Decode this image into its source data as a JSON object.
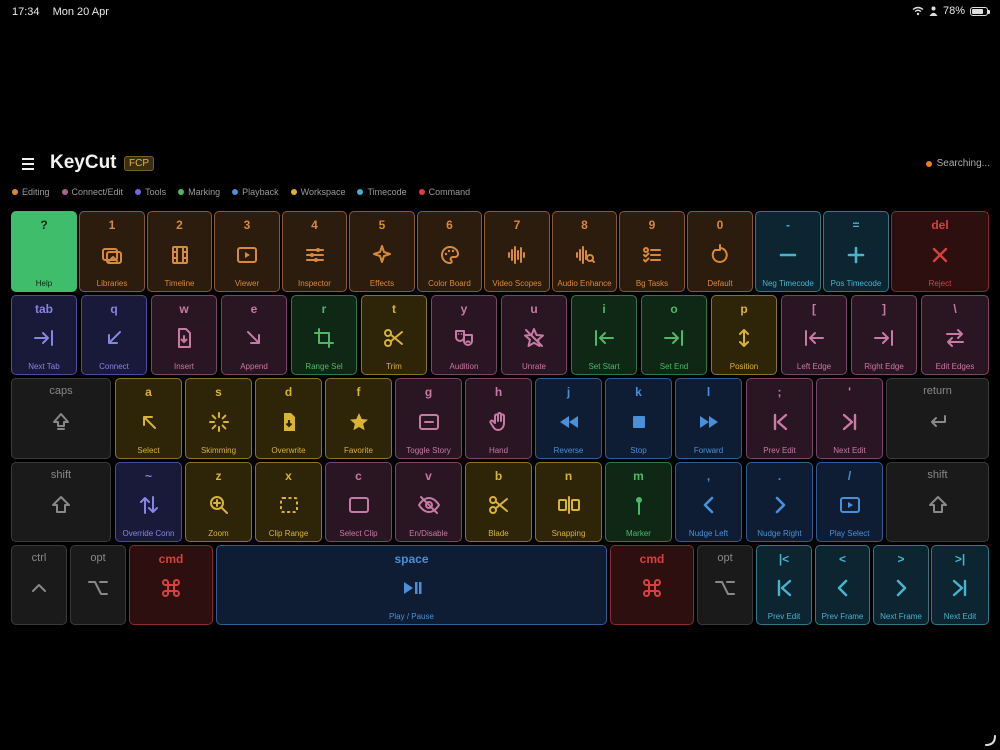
{
  "status_bar": {
    "time": "17:34",
    "date": "Mon 20 Apr",
    "battery": "78%"
  },
  "header": {
    "title": "KeyCut",
    "badge": "FCP",
    "status": "Searching..."
  },
  "colors": {
    "editing": "#d88a3a",
    "connect": "#b06090",
    "tools": "#6d6dd8",
    "marking": "#4fb868",
    "playback": "#4a90d8",
    "workspace": "#d8b430",
    "timecode": "#40b0c8",
    "command": "#d84040",
    "help": "#3fbd6a"
  },
  "legend": [
    {
      "label": "Editing",
      "color": "#d88a3a"
    },
    {
      "label": "Connect/Edit",
      "color": "#b06090"
    },
    {
      "label": "Tools",
      "color": "#6d6dd8"
    },
    {
      "label": "Marking",
      "color": "#4fb868"
    },
    {
      "label": "Playback",
      "color": "#4a90d8"
    },
    {
      "label": "Workspace",
      "color": "#d8b430"
    },
    {
      "label": "Timecode",
      "color": "#40b0c8"
    },
    {
      "label": "Command",
      "color": "#d84040"
    }
  ],
  "keys": [
    {
      "key": "?",
      "label": "Help",
      "cat": "help",
      "icon": ""
    },
    {
      "key": "1",
      "label": "Libraries",
      "cat": "editing",
      "icon": "libraries"
    },
    {
      "key": "2",
      "label": "Timeline",
      "cat": "editing",
      "icon": "film"
    },
    {
      "key": "3",
      "label": "Viewer",
      "cat": "editing",
      "icon": "play-box"
    },
    {
      "key": "4",
      "label": "Inspector",
      "cat": "editing",
      "icon": "sliders"
    },
    {
      "key": "5",
      "label": "Effects",
      "cat": "editing",
      "icon": "sparkle"
    },
    {
      "key": "6",
      "label": "Color Board",
      "cat": "editing",
      "icon": "palette"
    },
    {
      "key": "7",
      "label": "Video Scopes",
      "cat": "editing",
      "icon": "wave"
    },
    {
      "key": "8",
      "label": "Audio Enhance",
      "cat": "editing",
      "icon": "wave-search"
    },
    {
      "key": "9",
      "label": "Bg Tasks",
      "cat": "editing",
      "icon": "tasks"
    },
    {
      "key": "0",
      "label": "Default",
      "cat": "editing",
      "icon": "reset"
    },
    {
      "key": "-",
      "label": "Neg Timecode",
      "cat": "timecode",
      "icon": "minus"
    },
    {
      "key": "=",
      "label": "Pos Timecode",
      "cat": "timecode",
      "icon": "plus"
    },
    {
      "key": "del",
      "label": "Reject",
      "cat": "command",
      "icon": "x"
    },
    {
      "key": "tab",
      "label": "Next Tab",
      "cat": "tools",
      "icon": "arrow-right-bar"
    },
    {
      "key": "q",
      "label": "Connect",
      "cat": "tools",
      "icon": "arrow-down-left"
    },
    {
      "key": "w",
      "label": "Insert",
      "cat": "connect",
      "icon": "doc-in"
    },
    {
      "key": "e",
      "label": "Append",
      "cat": "connect",
      "icon": "arrow-down-right"
    },
    {
      "key": "r",
      "label": "Range Sel",
      "cat": "marking",
      "icon": "crop"
    },
    {
      "key": "t",
      "label": "Trim",
      "cat": "workspace",
      "icon": "scissors"
    },
    {
      "key": "y",
      "label": "Audition",
      "cat": "connect",
      "icon": "masks"
    },
    {
      "key": "u",
      "label": "Unrate",
      "cat": "connect",
      "icon": "star-slash"
    },
    {
      "key": "i",
      "label": "Set Start",
      "cat": "marking",
      "icon": "arrow-left-bar"
    },
    {
      "key": "o",
      "label": "Set End",
      "cat": "marking",
      "icon": "arrow-right-bar"
    },
    {
      "key": "p",
      "label": "Position",
      "cat": "workspace",
      "icon": "updown"
    },
    {
      "key": "[",
      "label": "Left Edge",
      "cat": "connect",
      "icon": "arrow-left-bar"
    },
    {
      "key": "]",
      "label": "Right Edge",
      "cat": "connect",
      "icon": "arrow-right-bar"
    },
    {
      "key": "\\",
      "label": "Edit Edges",
      "cat": "connect",
      "icon": "swap"
    },
    {
      "key": "caps",
      "label": "",
      "cat": "mod",
      "icon": "caps"
    },
    {
      "key": "a",
      "label": "Select",
      "cat": "workspace",
      "icon": "arrow-up-left"
    },
    {
      "key": "s",
      "label": "Skimming",
      "cat": "workspace",
      "icon": "burst"
    },
    {
      "key": "d",
      "label": "Overwrite",
      "cat": "workspace",
      "icon": "doc-down"
    },
    {
      "key": "f",
      "label": "Favorite",
      "cat": "workspace",
      "icon": "star"
    },
    {
      "key": "g",
      "label": "Toggle Story",
      "cat": "connect",
      "icon": "minus-box"
    },
    {
      "key": "h",
      "label": "Hand",
      "cat": "connect",
      "icon": "hand"
    },
    {
      "key": "j",
      "label": "Reverse",
      "cat": "playback",
      "icon": "rewind"
    },
    {
      "key": "k",
      "label": "Stop",
      "cat": "playback",
      "icon": "stop"
    },
    {
      "key": "l",
      "label": "Forward",
      "cat": "playback",
      "icon": "ffwd"
    },
    {
      "key": ";",
      "label": "Prev Edit",
      "cat": "connect",
      "icon": "prev-edit"
    },
    {
      "key": "'",
      "label": "Next Edit",
      "cat": "connect",
      "icon": "next-edit"
    },
    {
      "key": "return",
      "label": "",
      "cat": "mod",
      "icon": "return"
    },
    {
      "key": "shift",
      "label": "",
      "cat": "mod",
      "icon": "shift"
    },
    {
      "key": "~",
      "label": "Override Conn",
      "cat": "tools",
      "icon": "updown-arrows"
    },
    {
      "key": "z",
      "label": "Zoom",
      "cat": "workspace",
      "icon": "zoom"
    },
    {
      "key": "x",
      "label": "Clip Range",
      "cat": "workspace",
      "icon": "dash-box"
    },
    {
      "key": "c",
      "label": "Select Clip",
      "cat": "connect",
      "icon": "box"
    },
    {
      "key": "v",
      "label": "En/Disable",
      "cat": "connect",
      "icon": "eye-slash"
    },
    {
      "key": "b",
      "label": "Blade",
      "cat": "workspace",
      "icon": "scissors"
    },
    {
      "key": "n",
      "label": "Snapping",
      "cat": "workspace",
      "icon": "snap"
    },
    {
      "key": "m",
      "label": "Marker",
      "cat": "marking",
      "icon": "pin"
    },
    {
      "key": ",",
      "label": "Nudge Left",
      "cat": "playback",
      "icon": "chev-left"
    },
    {
      "key": ".",
      "label": "Nudge Right",
      "cat": "playback",
      "icon": "chev-right"
    },
    {
      "key": "/",
      "label": "Play Select",
      "cat": "playback",
      "icon": "play-box"
    },
    {
      "key": "shift",
      "label": "",
      "cat": "mod",
      "icon": "shift"
    },
    {
      "key": "ctrl",
      "label": "",
      "cat": "mod",
      "icon": "ctrl"
    },
    {
      "key": "opt",
      "label": "",
      "cat": "mod",
      "icon": "opt"
    },
    {
      "key": "cmd",
      "label": "",
      "cat": "command",
      "icon": "cmd"
    },
    {
      "key": "space",
      "label": "Play / Pause",
      "cat": "playback",
      "icon": "playpause"
    },
    {
      "key": "cmd",
      "label": "",
      "cat": "command",
      "icon": "cmd"
    },
    {
      "key": "opt",
      "label": "",
      "cat": "mod",
      "icon": "opt"
    },
    {
      "key": "|<",
      "label": "Prev Edit",
      "cat": "timecode",
      "icon": "prev-edit"
    },
    {
      "key": "<",
      "label": "Prev Frame",
      "cat": "timecode",
      "icon": "chev-left"
    },
    {
      "key": ">",
      "label": "Next Frame",
      "cat": "timecode",
      "icon": "chev-right"
    },
    {
      "key": ">|",
      "label": "Next Edit",
      "cat": "timecode",
      "icon": "next-edit"
    }
  ]
}
